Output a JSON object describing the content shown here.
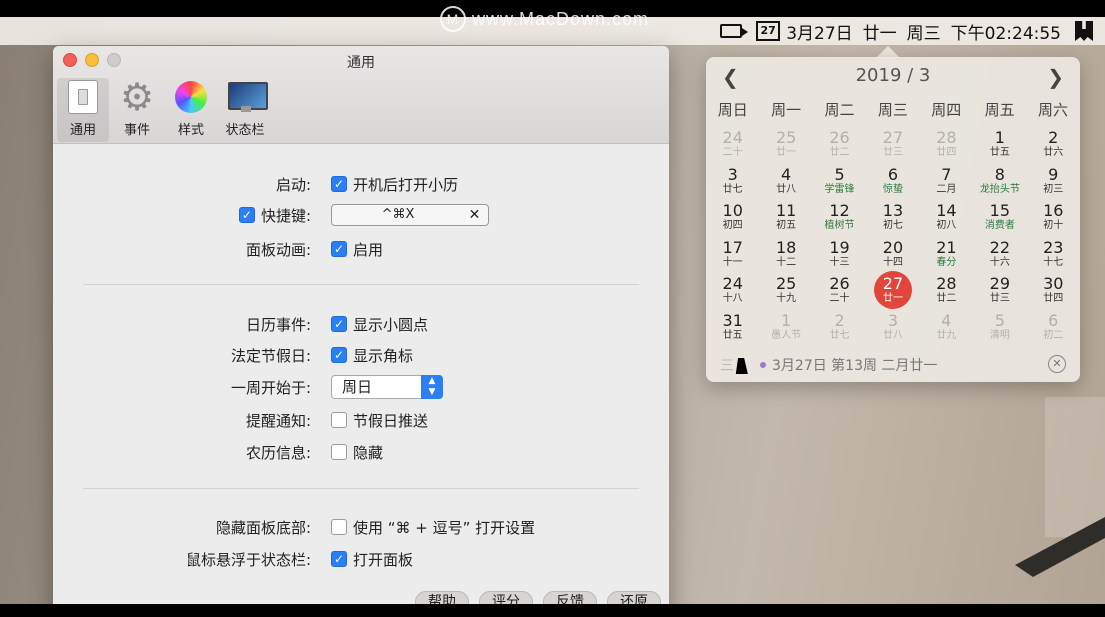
{
  "watermark": {
    "logo": "M",
    "text": "www.MacDown.com"
  },
  "menubar": {
    "calendar_icon_day": "27",
    "date": "3月27日",
    "lunar": "廿一",
    "weekday": "周三",
    "time": "下午02:24:55",
    "icons": [
      "camera-icon",
      "calendar-icon",
      "app-icon"
    ]
  },
  "window": {
    "title": "通用",
    "tabs": [
      {
        "label": "通用",
        "icon": "switch-icon"
      },
      {
        "label": "事件",
        "icon": "gear-icon"
      },
      {
        "label": "样式",
        "icon": "color-wheel-icon"
      },
      {
        "label": "状态栏",
        "icon": "monitor-icon"
      }
    ],
    "settings": {
      "startup": {
        "label": "启动:",
        "option": "开机后打开小历",
        "checked": true
      },
      "hotkey": {
        "label": "快捷键:",
        "checked": true,
        "value": "^⌘X",
        "clear": "✕"
      },
      "animation": {
        "label": "面板动画:",
        "option": "启用",
        "checked": true
      },
      "events": {
        "label": "日历事件:",
        "option": "显示小圆点",
        "checked": true
      },
      "holidays": {
        "label": "法定节假日:",
        "option": "显示角标",
        "checked": true
      },
      "week_start": {
        "label": "一周开始于:",
        "value": "周日"
      },
      "reminders": {
        "label": "提醒通知:",
        "option": "节假日推送",
        "checked": false
      },
      "lunar_info": {
        "label": "农历信息:",
        "option": "隐藏",
        "checked": false
      },
      "hide_bottom": {
        "label": "隐藏面板底部:",
        "option": "使用 “⌘ + 逗号” 打开设置",
        "checked": false
      },
      "hover": {
        "label": "鼠标悬浮于状态栏:",
        "option": "打开面板",
        "checked": true
      }
    },
    "buttons": [
      "帮助",
      "评分",
      "反馈",
      "还原"
    ]
  },
  "calendar": {
    "title": "2019 / 3",
    "prev": "❮",
    "next": "❯",
    "weekdays": [
      "周日",
      "周一",
      "周二",
      "周三",
      "周四",
      "周五",
      "周六"
    ],
    "weeks": [
      [
        [
          "24",
          "二十",
          1
        ],
        [
          "25",
          "廿一",
          1
        ],
        [
          "26",
          "廿二",
          1
        ],
        [
          "27",
          "廿三",
          1
        ],
        [
          "28",
          "廿四",
          1
        ],
        [
          "1",
          "廿五",
          0
        ],
        [
          "2",
          "廿六",
          0
        ]
      ],
      [
        [
          "3",
          "廿七",
          0
        ],
        [
          "4",
          "廿八",
          0
        ],
        [
          "5",
          "学雷锋",
          0,
          1
        ],
        [
          "6",
          "惊蛰",
          0,
          1
        ],
        [
          "7",
          "二月",
          0
        ],
        [
          "8",
          "龙抬头节",
          0,
          1
        ],
        [
          "9",
          "初三",
          0
        ]
      ],
      [
        [
          "10",
          "初四",
          0
        ],
        [
          "11",
          "初五",
          0
        ],
        [
          "12",
          "植树节",
          0,
          1
        ],
        [
          "13",
          "初七",
          0
        ],
        [
          "14",
          "初八",
          0
        ],
        [
          "15",
          "消费者",
          0,
          1
        ],
        [
          "16",
          "初十",
          0
        ]
      ],
      [
        [
          "17",
          "十一",
          0
        ],
        [
          "18",
          "十二",
          0
        ],
        [
          "19",
          "十三",
          0
        ],
        [
          "20",
          "十四",
          0
        ],
        [
          "21",
          "春分",
          0,
          1
        ],
        [
          "22",
          "十六",
          0
        ],
        [
          "23",
          "十七",
          0
        ]
      ],
      [
        [
          "24",
          "十八",
          0
        ],
        [
          "25",
          "十九",
          0
        ],
        [
          "26",
          "二十",
          0
        ],
        [
          "27",
          "廿一",
          0,
          0,
          1
        ],
        [
          "28",
          "廿二",
          0
        ],
        [
          "29",
          "廿三",
          0
        ],
        [
          "30",
          "廿四",
          0
        ]
      ],
      [
        [
          "31",
          "廿五",
          0
        ],
        [
          "1",
          "愚人节",
          1
        ],
        [
          "2",
          "廿七",
          1
        ],
        [
          "3",
          "廿八",
          1
        ],
        [
          "4",
          "廿九",
          1
        ],
        [
          "5",
          "清明",
          1
        ],
        [
          "6",
          "初二",
          1
        ]
      ]
    ],
    "footer_prefix": "三",
    "footer": "3月27日 第13周 二月廿一",
    "close": "✕"
  }
}
